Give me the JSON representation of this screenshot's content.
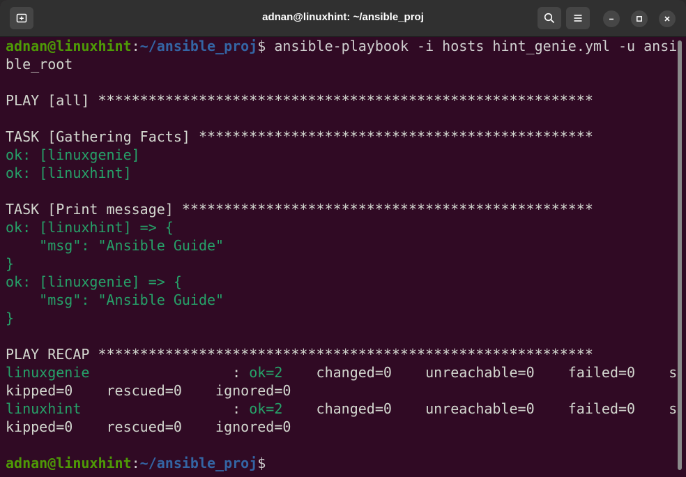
{
  "window": {
    "title": "adnan@linuxhint: ~/ansible_proj"
  },
  "colors": {
    "background": "#300a24",
    "titlebar": "#303030",
    "prompt_user": "#4e9a06",
    "prompt_path": "#3465a4",
    "ok_text": "#26a269",
    "default_text": "#d3d7cf"
  },
  "icons": {
    "new_tab": "new-tab-icon",
    "search": "search-icon",
    "menu": "hamburger-menu-icon",
    "minimize": "minimize-icon",
    "maximize": "maximize-icon",
    "close": "close-icon"
  },
  "terminal": {
    "prompt_user": "adnan@linuxhint",
    "prompt_colon": ":",
    "prompt_path": "~/ansible_proj",
    "prompt_dollar": "$",
    "command_line1": " ansible-playbook -i hosts hint_genie.yml -u ansi",
    "command_line2": "ble_root",
    "play_header": "PLAY [all] ***********************************************************",
    "task1_header": "TASK [Gathering Facts] ***********************************************",
    "task1_ok1": "ok: [linuxgenie]",
    "task1_ok2": "ok: [linuxhint]",
    "task2_header": "TASK [Print message] *************************************************",
    "task2_ok1_open": "ok: [linuxhint] => {",
    "task2_ok1_msg": "    \"msg\": \"Ansible Guide\"",
    "task2_ok1_close": "}",
    "task2_ok2_open": "ok: [linuxgenie] => {",
    "task2_ok2_msg": "    \"msg\": \"Ansible Guide\"",
    "task2_ok2_close": "}",
    "recap_header": "PLAY RECAP ***********************************************************",
    "recap": [
      {
        "host": "linuxgenie                 ",
        "sep": ": ",
        "ok": "ok=2",
        "rest_line1": "    changed=0    unreachable=0    failed=0    s",
        "rest_line2": "kipped=0    rescued=0    ignored=0"
      },
      {
        "host": "linuxhint                  ",
        "sep": ": ",
        "ok": "ok=2",
        "rest_line1": "    changed=0    unreachable=0    failed=0    s",
        "rest_line2": "kipped=0    rescued=0    ignored=0"
      }
    ]
  }
}
